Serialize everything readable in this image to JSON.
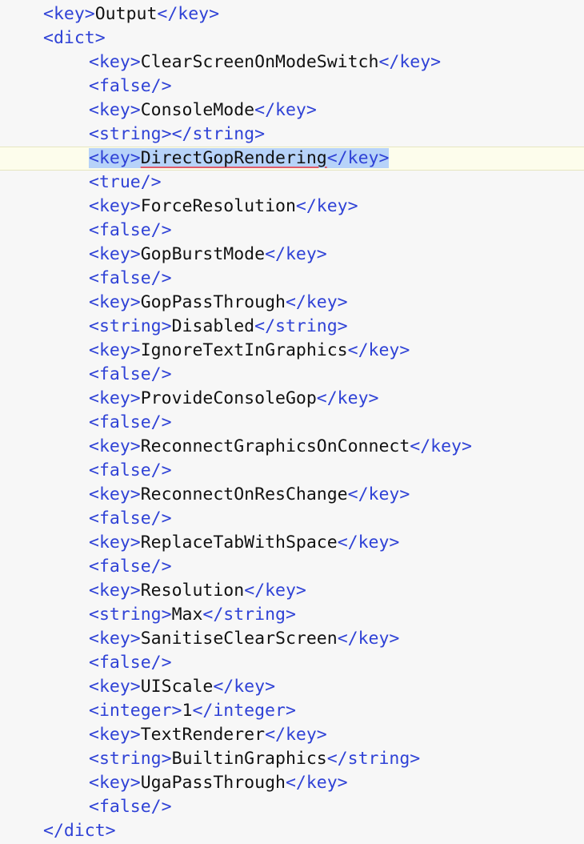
{
  "lines": [
    {
      "indent": 1,
      "open": "<key>",
      "text": "Output",
      "close": "</key>"
    },
    {
      "indent": 1,
      "open": "<dict>",
      "text": "",
      "close": ""
    },
    {
      "indent": 2,
      "open": "<key>",
      "text": "ClearScreenOnModeSwitch",
      "close": "</key>"
    },
    {
      "indent": 2,
      "open": "<false/>",
      "text": "",
      "close": ""
    },
    {
      "indent": 2,
      "open": "<key>",
      "text": "ConsoleMode",
      "close": "</key>"
    },
    {
      "indent": 2,
      "open": "<string>",
      "text": "",
      "close": "</string>"
    },
    {
      "indent": 2,
      "open": "<key>",
      "text": "DirectGopRendering",
      "close": "</key>",
      "current": true,
      "selected": true,
      "squiggle": true
    },
    {
      "indent": 2,
      "open": "<true/>",
      "text": "",
      "close": ""
    },
    {
      "indent": 2,
      "open": "<key>",
      "text": "ForceResolution",
      "close": "</key>"
    },
    {
      "indent": 2,
      "open": "<false/>",
      "text": "",
      "close": ""
    },
    {
      "indent": 2,
      "open": "<key>",
      "text": "GopBurstMode",
      "close": "</key>"
    },
    {
      "indent": 2,
      "open": "<false/>",
      "text": "",
      "close": ""
    },
    {
      "indent": 2,
      "open": "<key>",
      "text": "GopPassThrough",
      "close": "</key>"
    },
    {
      "indent": 2,
      "open": "<string>",
      "text": "Disabled",
      "close": "</string>"
    },
    {
      "indent": 2,
      "open": "<key>",
      "text": "IgnoreTextInGraphics",
      "close": "</key>"
    },
    {
      "indent": 2,
      "open": "<false/>",
      "text": "",
      "close": ""
    },
    {
      "indent": 2,
      "open": "<key>",
      "text": "ProvideConsoleGop",
      "close": "</key>"
    },
    {
      "indent": 2,
      "open": "<false/>",
      "text": "",
      "close": ""
    },
    {
      "indent": 2,
      "open": "<key>",
      "text": "ReconnectGraphicsOnConnect",
      "close": "</key>"
    },
    {
      "indent": 2,
      "open": "<false/>",
      "text": "",
      "close": ""
    },
    {
      "indent": 2,
      "open": "<key>",
      "text": "ReconnectOnResChange",
      "close": "</key>"
    },
    {
      "indent": 2,
      "open": "<false/>",
      "text": "",
      "close": ""
    },
    {
      "indent": 2,
      "open": "<key>",
      "text": "ReplaceTabWithSpace",
      "close": "</key>"
    },
    {
      "indent": 2,
      "open": "<false/>",
      "text": "",
      "close": ""
    },
    {
      "indent": 2,
      "open": "<key>",
      "text": "Resolution",
      "close": "</key>"
    },
    {
      "indent": 2,
      "open": "<string>",
      "text": "Max",
      "close": "</string>"
    },
    {
      "indent": 2,
      "open": "<key>",
      "text": "SanitiseClearScreen",
      "close": "</key>"
    },
    {
      "indent": 2,
      "open": "<false/>",
      "text": "",
      "close": ""
    },
    {
      "indent": 2,
      "open": "<key>",
      "text": "UIScale",
      "close": "</key>"
    },
    {
      "indent": 2,
      "open": "<integer>",
      "text": "1",
      "close": "</integer>"
    },
    {
      "indent": 2,
      "open": "<key>",
      "text": "TextRenderer",
      "close": "</key>"
    },
    {
      "indent": 2,
      "open": "<string>",
      "text": "BuiltinGraphics",
      "close": "</string>"
    },
    {
      "indent": 2,
      "open": "<key>",
      "text": "UgaPassThrough",
      "close": "</key>"
    },
    {
      "indent": 2,
      "open": "<false/>",
      "text": "",
      "close": ""
    },
    {
      "indent": 1,
      "open": "</dict>",
      "text": "",
      "close": ""
    }
  ],
  "colors": {
    "tag": "#2f42d6",
    "text": "#111111",
    "background": "#f7f7f7",
    "current_line": "#fdfdec",
    "selection": "#b7d3f9",
    "squiggle": "#e05c6b"
  }
}
